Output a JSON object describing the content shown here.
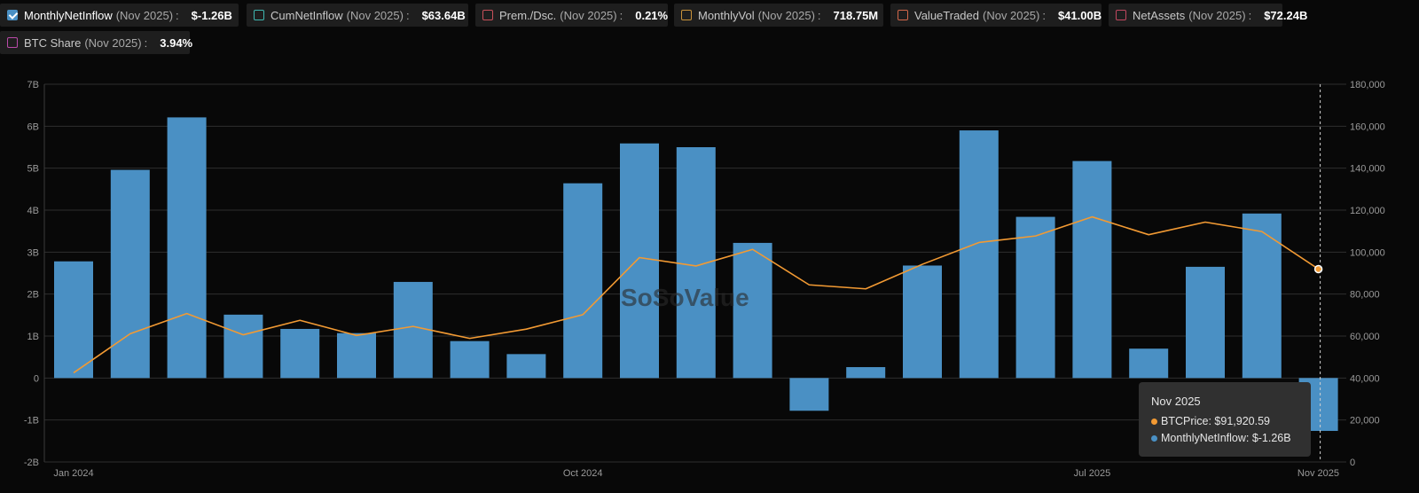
{
  "legend": [
    {
      "name": "MonthlyNetInflow",
      "period": "(Nov 2025)",
      "value": "$-1.26B",
      "color": "#4a90c4",
      "checked": true
    },
    {
      "name": "CumNetInflow",
      "period": "(Nov 2025)",
      "value": "$63.64B",
      "color": "#3fb6b0",
      "checked": false
    },
    {
      "name": "Prem./Dsc.",
      "period": "(Nov 2025)",
      "value": "0.21%",
      "color": "#c9505a",
      "checked": false
    },
    {
      "name": "MonthlyVol",
      "period": "(Nov 2025)",
      "value": "718.75M",
      "color": "#c8923a",
      "checked": false
    },
    {
      "name": "ValueTraded",
      "period": "(Nov 2025)",
      "value": "$41.00B",
      "color": "#d2674a",
      "checked": false
    },
    {
      "name": "NetAssets",
      "period": "(Nov 2025)",
      "value": "$72.24B",
      "color": "#c0485f",
      "checked": false
    },
    {
      "name": "BTC Share",
      "period": "(Nov 2025)",
      "value": "3.94%",
      "color": "#b94aa8",
      "checked": false
    }
  ],
  "colon": ":",
  "watermark": "SoSoValue",
  "tooltip": {
    "title": "Nov 2025",
    "rows": [
      {
        "label": "BTCPrice: $91,920.59",
        "color": "#f29a33"
      },
      {
        "label": "MonthlyNetInflow: $-1.26B",
        "color": "#4a90c4"
      }
    ]
  },
  "chart_data": {
    "type": "bar",
    "categories": [
      "Jan 2024",
      "Feb 2024",
      "Mar 2024",
      "Apr 2024",
      "May 2024",
      "Jun 2024",
      "Jul 2024",
      "Aug 2024",
      "Sep 2024",
      "Oct 2024",
      "Nov 2024",
      "Dec 2024",
      "Jan 2025",
      "Feb 2025",
      "Mar 2025",
      "Apr 2025",
      "May 2025",
      "Jun 2025",
      "Jul 2025",
      "Aug 2025",
      "Sep 2025",
      "Oct 2025",
      "Nov 2025"
    ],
    "x_tick_labels": [
      {
        "index": 0,
        "label": "Jan 2024"
      },
      {
        "index": 9,
        "label": "Oct 2024"
      },
      {
        "index": 18,
        "label": "Jul 2025"
      },
      {
        "index": 22,
        "label": "Nov 2025"
      }
    ],
    "series": [
      {
        "name": "MonthlyNetInflow",
        "axis": "left",
        "kind": "bar",
        "color": "#4a90c4",
        "values": [
          2.78,
          4.96,
          6.21,
          1.51,
          1.17,
          1.07,
          2.29,
          0.88,
          0.57,
          4.64,
          5.59,
          5.5,
          3.22,
          -0.78,
          0.26,
          2.68,
          5.9,
          3.84,
          5.17,
          0.7,
          2.65,
          3.92,
          -1.26
        ]
      },
      {
        "name": "BTCPrice",
        "axis": "right",
        "kind": "line",
        "color": "#f29a33",
        "values": [
          42500,
          61100,
          70700,
          60600,
          67500,
          60300,
          64600,
          58900,
          63300,
          70200,
          97400,
          93400,
          101300,
          84400,
          82500,
          94200,
          104600,
          107700,
          116800,
          108300,
          114300,
          109800,
          91920.59
        ]
      }
    ],
    "y_left": {
      "min": -2,
      "max": 7,
      "step": 1,
      "ticks": [
        "-2B",
        "-1B",
        "0",
        "1B",
        "2B",
        "3B",
        "4B",
        "5B",
        "6B",
        "7B"
      ]
    },
    "y_right": {
      "min": 0,
      "max": 180000,
      "step": 20000,
      "ticks": [
        "0",
        "20,000",
        "40,000",
        "60,000",
        "80,000",
        "100,000",
        "120,000",
        "140,000",
        "160,000",
        "180,000"
      ]
    },
    "grid": true,
    "highlight_index": 22
  }
}
